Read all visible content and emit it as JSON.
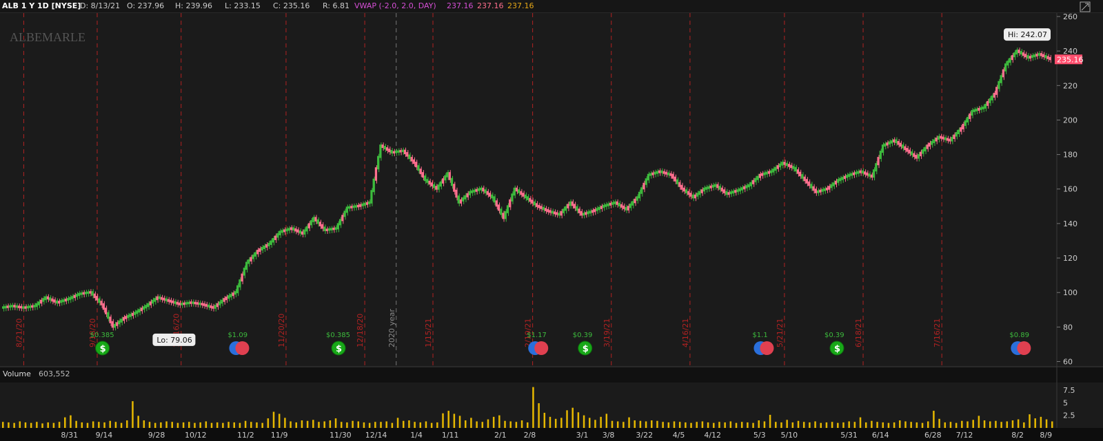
{
  "header": {
    "symbol": "ALB 1 Y 1D [NYSE]",
    "date": "D: 8/13/21",
    "open": "O: 237.96",
    "high": "H: 239.96",
    "low": "L: 233.15",
    "close": "C: 235.16",
    "range": "R: 6.81",
    "vwap_label": "VWAP (-2.0, 2.0, DAY)",
    "vwap_values": [
      "237.16",
      "237.16",
      "237.16"
    ]
  },
  "watermark": "ALBEMARLE",
  "volume_panel": {
    "label": "Volume",
    "value": "603,552"
  },
  "colors": {
    "up": "#3dbb3d",
    "down": "#ff6f8e",
    "volume": "#e6b800",
    "vwap1": "#d64fd6",
    "vwap2": "#ff6f8e",
    "vwap3": "#e6a817",
    "grid_event": "#b22222",
    "last_price_bg": "#ff4f6e"
  },
  "chart_data": {
    "type": "line",
    "price": {
      "ylim": [
        57,
        262
      ],
      "yticks": [
        60,
        80,
        100,
        120,
        140,
        160,
        180,
        200,
        220,
        240,
        260
      ],
      "last_price": "235.16",
      "hi_label": "Hi: 242.07",
      "lo_label": "Lo: 79.06",
      "series": [
        {
          "name": "ALB",
          "x": [
            0,
            5,
            10,
            15,
            20,
            25,
            30,
            33,
            38,
            43,
            48,
            53,
            55,
            58,
            63,
            68,
            73,
            78,
            83,
            88,
            93,
            95,
            98,
            101,
            105,
            110,
            115,
            120,
            125,
            130,
            135,
            140,
            145,
            150,
            155,
            160,
            165,
            170,
            175,
            180,
            185,
            190,
            195,
            200,
            205,
            210,
            215,
            220,
            225,
            230,
            235,
            240,
            245,
            250,
            252
          ],
          "values": [
            91,
            92,
            91,
            92,
            97,
            94,
            96,
            99,
            100,
            93,
            80,
            85,
            88,
            92,
            97,
            95,
            93,
            94,
            93,
            91,
            96,
            100,
            117,
            124,
            128,
            135,
            137,
            134,
            143,
            136,
            137,
            149,
            150,
            152,
            185,
            181,
            182,
            175,
            165,
            160,
            169,
            152,
            158,
            160,
            155,
            143,
            160,
            155,
            150,
            147,
            145,
            152,
            145,
            147,
            150
          ]
        }
      ],
      "series_ext": {
        "x": [
          255,
          260,
          265,
          270,
          275,
          280,
          285,
          290,
          295,
          300,
          305,
          310,
          315,
          320,
          325,
          330,
          335,
          340,
          345,
          350,
          355,
          360,
          365,
          370,
          375,
          380,
          385,
          390,
          395,
          400,
          405,
          410,
          415,
          420,
          425,
          430,
          435,
          440,
          445,
          450,
          455,
          460,
          465,
          470,
          475,
          480,
          485,
          490,
          495,
          500,
          505,
          510,
          515,
          520,
          525,
          530
        ],
        "values": [
          152,
          148,
          155,
          168,
          170,
          168,
          160,
          155,
          160,
          162,
          157,
          159,
          162,
          168,
          170,
          175,
          172,
          165,
          158,
          160,
          165,
          168,
          170,
          167,
          185,
          188,
          183,
          178,
          185,
          190,
          188,
          195,
          205,
          207,
          215,
          232,
          240,
          236,
          238,
          235.16,
          235.16,
          235.16,
          235.16,
          235.16,
          235.16,
          235.16,
          235.16,
          235.16,
          235.16,
          235.16,
          235.16,
          235.16,
          235.16,
          235.16,
          235.16,
          235.16
        ]
      }
    },
    "x_tick_labels": [
      "8/31",
      "9/14",
      "9/28",
      "10/12",
      "11/2",
      "11/9",
      "11/30",
      "12/14",
      "1/4",
      "1/11",
      "2/1",
      "2/8",
      "3/1",
      "3/8",
      "3/22",
      "4/5",
      "4/12",
      "5/3",
      "5/10",
      "5/31",
      "6/14",
      "6/28",
      "7/12",
      "8/2",
      "8/9"
    ],
    "event_lines": [
      "8/21/20",
      "9/18/20",
      "10/16/20",
      "11/20/20",
      "12/18/20",
      "2020 year",
      "1/15/21",
      "2/19/21",
      "3/19/21",
      "4/16/21",
      "5/21/21",
      "6/18/21",
      "7/16/21"
    ],
    "dividends": [
      "$0.385",
      "$0.385",
      "$0.39",
      "$0.39"
    ],
    "earnings": [
      "$1.09",
      "$1.17",
      "$1.1",
      "$0.89"
    ],
    "volume": {
      "yticks": [
        "7.5",
        "5",
        "2.5"
      ],
      "values": [
        1.2,
        1.1,
        1.0,
        1.3,
        1.1,
        1.0,
        1.2,
        0.9,
        1.1,
        1.0,
        1.2,
        2.1,
        2.5,
        1.4,
        1.1,
        1.0,
        1.3,
        1.2,
        1.1,
        1.4,
        1.2,
        1.0,
        1.5,
        5.3,
        2.4,
        1.5,
        1.2,
        1.0,
        1.1,
        1.3,
        1.2,
        1.0,
        1.1,
        1.2,
        1.0,
        1.1,
        1.3,
        1.0,
        1.1,
        1.0,
        1.2,
        1.1,
        1.0,
        1.4,
        1.2,
        1.1,
        1.0,
        1.9,
        3.2,
        2.8,
        2.0,
        1.3,
        1.1,
        1.5,
        1.4,
        1.6,
        1.2,
        1.3,
        1.5,
        1.9,
        1.2,
        1.1,
        1.4,
        1.3,
        1.1,
        1.0,
        1.2,
        1.2,
        1.3,
        1.0,
        2.0,
        1.4,
        1.5,
        1.2,
        1.1,
        1.3,
        1.0,
        1.1,
        2.9,
        3.4,
        2.8,
        2.4,
        1.5,
        2.0,
        1.3,
        1.2,
        1.7,
        2.2,
        2.5,
        1.4,
        1.3,
        1.2,
        1.5,
        1.1,
        8.1,
        4.9,
        3.0,
        2.2,
        1.8,
        2.0,
        3.5,
        4.0,
        3.1,
        2.5,
        2.0,
        1.6,
        2.2,
        2.8,
        1.4,
        1.3,
        1.2,
        2.1,
        1.5,
        1.4,
        1.3,
        1.5,
        1.4,
        1.2,
        1.1,
        1.3,
        1.2,
        1.1,
        1.0,
        1.2,
        1.3,
        1.1,
        1.0,
        1.2,
        1.1,
        1.3,
        1.0,
        1.2,
        1.1,
        1.0,
        1.5,
        1.3,
        2.6,
        1.2,
        1.1,
        1.6,
        1.1,
        1.4,
        1.2,
        1.1,
        1.3,
        1.0,
        1.1,
        1.2,
        1.0,
        1.1,
        1.3,
        1.2,
        2.1,
        1.1,
        1.4,
        1.2,
        1.1,
        1.0,
        1.1,
        1.5,
        1.3,
        1.2,
        1.1,
        1.0,
        1.3,
        3.4,
        1.8,
        1.1,
        1.2,
        1.0,
        1.4,
        1.3,
        1.6,
        2.4,
        1.5,
        1.3,
        1.4,
        1.2,
        1.3,
        1.5,
        1.7,
        1.1,
        2.7,
        1.9,
        2.2,
        1.7,
        1.3
      ]
    }
  }
}
